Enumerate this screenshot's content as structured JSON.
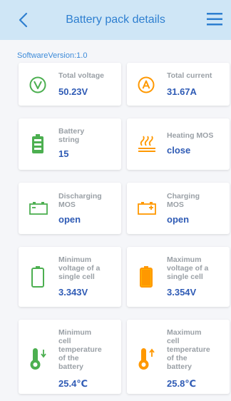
{
  "header": {
    "title": "Battery pack details"
  },
  "software_version": "SoftwareVersion:1.0",
  "cards": [
    {
      "label": "Total voltage",
      "value": "50.23V",
      "icon": "voltage-icon",
      "color": "#4caf50"
    },
    {
      "label": "Total current",
      "value": "31.67A",
      "icon": "current-icon",
      "color": "#ff9800"
    },
    {
      "label": "Battery string",
      "value": "15",
      "icon": "battery-string-icon",
      "color": "#4caf50"
    },
    {
      "label": "Heating MOS",
      "value": "close",
      "icon": "heating-icon",
      "color": "#ff9800"
    },
    {
      "label": "Discharging MOS",
      "value": "open",
      "icon": "discharging-icon",
      "color": "#4caf50"
    },
    {
      "label": "Charging MOS",
      "value": "open",
      "icon": "charging-icon",
      "color": "#ff9800"
    },
    {
      "label": "Minimum voltage of a single cell",
      "value": "3.343V",
      "icon": "battery-low-icon",
      "color": "#4caf50"
    },
    {
      "label": "Maximum voltage of a single cell",
      "value": "3.354V",
      "icon": "battery-high-icon",
      "color": "#ff9800"
    },
    {
      "label": "Minimum cell temperature of the battery",
      "value": "25.4℃",
      "icon": "thermometer-down-icon",
      "color": "#4caf50"
    },
    {
      "label": "Maximum cell temperature of the battery",
      "value": "25.8℃",
      "icon": "thermometer-up-icon",
      "color": "#ff9800"
    }
  ],
  "colors": {
    "header_bg": "#cfe6f6",
    "accent": "#2e7fd0",
    "value": "#2f5bb5",
    "label": "#9aa0a6",
    "green": "#4caf50",
    "orange": "#ff9800"
  }
}
